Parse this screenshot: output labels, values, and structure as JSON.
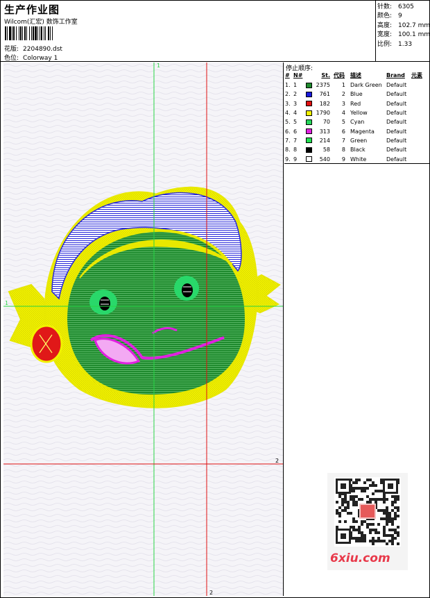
{
  "header": {
    "title": "生产作业图",
    "company": "Wilcom(汇宏) 数饰工作室",
    "design_label": "花版:",
    "design_value": "2204890.dst",
    "colorway_label": "色位:",
    "colorway_value": "Colorway 1"
  },
  "stats": [
    {
      "label": "针数:",
      "value": "6305"
    },
    {
      "label": "颜色:",
      "value": "9"
    },
    {
      "label": "高度:",
      "value": "102.7 mm"
    },
    {
      "label": "宽度:",
      "value": "100.1 mm"
    },
    {
      "label": "比例:",
      "value": "1.33"
    }
  ],
  "stop_sequence": {
    "title": "停止顺序:",
    "headers": [
      "#",
      "N#",
      "St.",
      "代码",
      "描述",
      "Brand",
      "元素"
    ],
    "rows": [
      {
        "index": "1.",
        "n": "1",
        "color": "#1f8a2e",
        "stitches": "2375",
        "code": "1",
        "desc": "Dark Green",
        "brand": "Default"
      },
      {
        "index": "2.",
        "n": "2",
        "color": "#1a1adb",
        "stitches": "761",
        "code": "2",
        "desc": "Blue",
        "brand": "Default"
      },
      {
        "index": "3.",
        "n": "3",
        "color": "#e01010",
        "stitches": "182",
        "code": "3",
        "desc": "Red",
        "brand": "Default"
      },
      {
        "index": "4.",
        "n": "4",
        "color": "#f2f200",
        "stitches": "1790",
        "code": "4",
        "desc": "Yellow",
        "brand": "Default"
      },
      {
        "index": "5.",
        "n": "5",
        "color": "#26d65a",
        "stitches": "70",
        "code": "5",
        "desc": "Cyan",
        "brand": "Default"
      },
      {
        "index": "6.",
        "n": "6",
        "color": "#e020e0",
        "stitches": "313",
        "code": "6",
        "desc": "Magenta",
        "brand": "Default"
      },
      {
        "index": "7.",
        "n": "7",
        "color": "#22e050",
        "stitches": "214",
        "code": "7",
        "desc": "Green",
        "brand": "Default"
      },
      {
        "index": "8.",
        "n": "8",
        "color": "#000000",
        "stitches": "58",
        "code": "8",
        "desc": "Black",
        "brand": "Default"
      },
      {
        "index": "9.",
        "n": "9",
        "color": "#ffffff",
        "stitches": "540",
        "code": "9",
        "desc": "White",
        "brand": "Default"
      }
    ]
  },
  "guides": {
    "v1_label": "1",
    "h1_label": "1",
    "v2_label": "2",
    "h2_label": "2"
  },
  "watermark": {
    "site": "6xiu.com"
  }
}
